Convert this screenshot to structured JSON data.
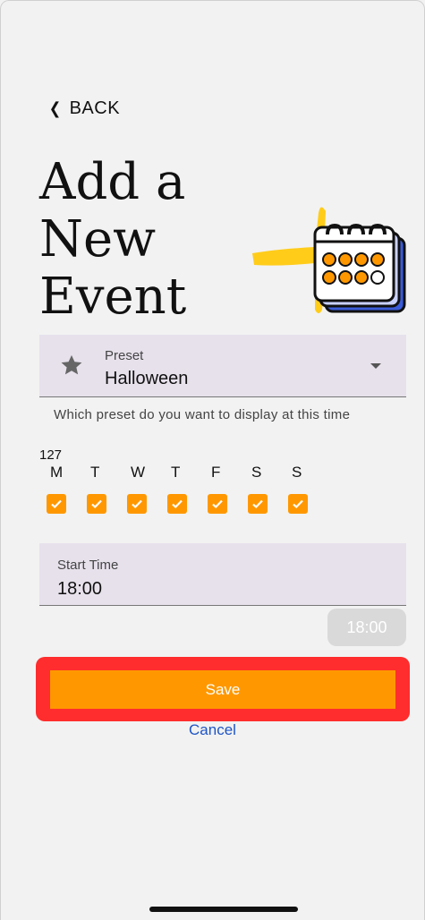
{
  "header": {
    "back_label": "BACK",
    "title_line1": "Add a New",
    "title_line2": "Event"
  },
  "preset": {
    "label": "Preset",
    "value": "Halloween",
    "helper": "Which preset do you want to display at this time",
    "icon": "star-icon"
  },
  "days": {
    "count": "127",
    "items": [
      {
        "letter": "M",
        "checked": true
      },
      {
        "letter": "T",
        "checked": true
      },
      {
        "letter": "W",
        "checked": true
      },
      {
        "letter": "T",
        "checked": true
      },
      {
        "letter": "F",
        "checked": true
      },
      {
        "letter": "S",
        "checked": true
      },
      {
        "letter": "S",
        "checked": true
      }
    ]
  },
  "start_time": {
    "label": "Start Time",
    "value": "18:00",
    "chip": "18:00"
  },
  "actions": {
    "save_label": "Save",
    "cancel_label": "Cancel"
  },
  "colors": {
    "accent": "#ff9800",
    "highlight": "#ff2d2d",
    "link": "#1e55c6",
    "field_bg": "#e7e1ec"
  }
}
